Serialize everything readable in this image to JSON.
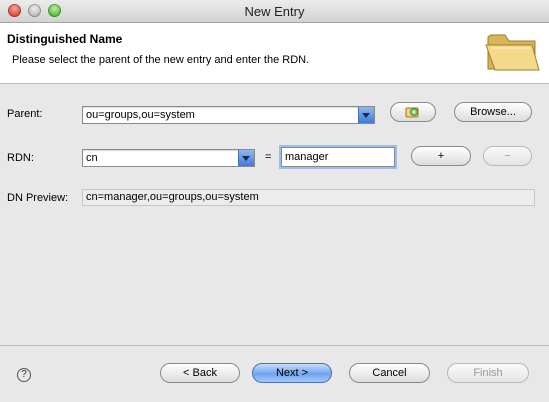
{
  "window": {
    "title": "New Entry"
  },
  "header": {
    "title": "Distinguished Name",
    "description": "Please select the parent of the new entry and enter the RDN."
  },
  "parent": {
    "label": "Parent:",
    "value": "ou=groups,ou=system",
    "browse_label": "Browse..."
  },
  "rdn": {
    "label": "RDN:",
    "type_value": "cn",
    "equals": "=",
    "value": "manager",
    "add_label": "+",
    "remove_label": "−"
  },
  "preview": {
    "label": "DN Preview:",
    "value": "cn=manager,ou=groups,ou=system"
  },
  "footer": {
    "help": "?",
    "back_label": "< Back",
    "next_label": "Next >",
    "cancel_label": "Cancel",
    "finish_label": "Finish"
  }
}
